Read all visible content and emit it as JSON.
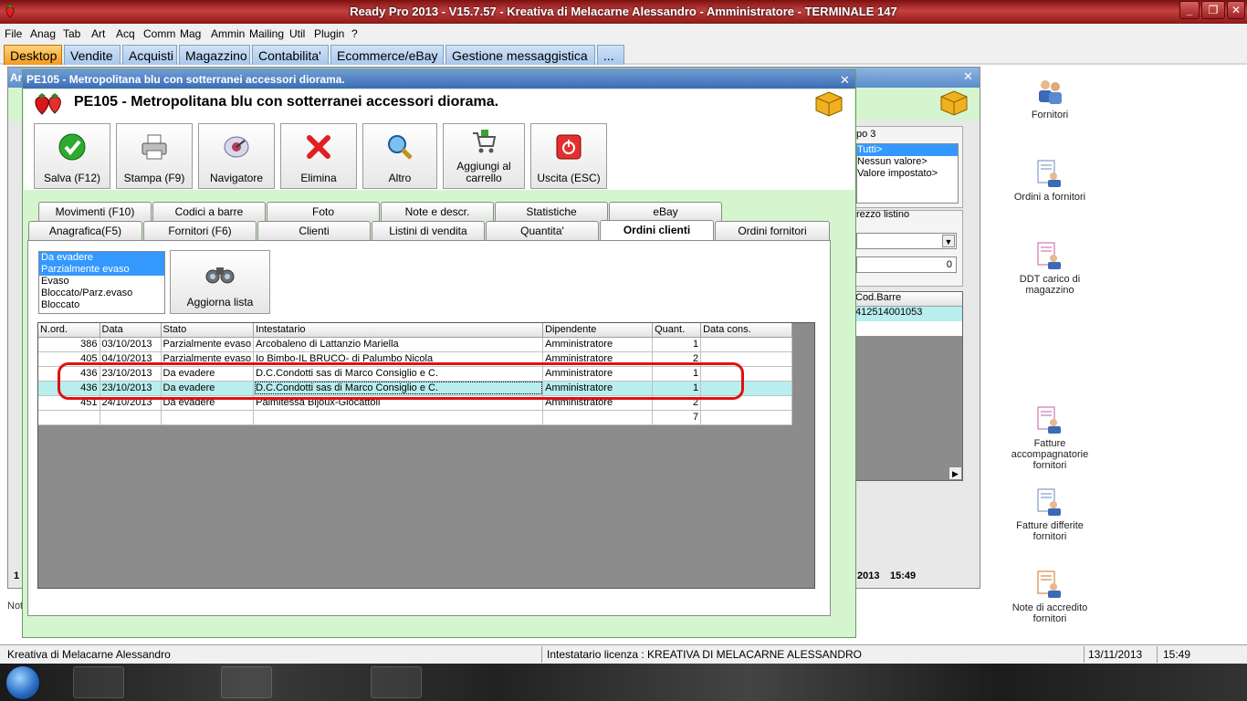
{
  "window": {
    "title": "Ready Pro 2013 - V15.7.57 - Kreativa di Melacarne Alessandro - Amministratore - TERMINALE 147"
  },
  "menu": [
    "File",
    "Anag",
    "Tab",
    "Art",
    "Acq",
    "Comm",
    "Mag",
    "Ammin",
    "Mailing",
    "Util",
    "Plugin",
    "?"
  ],
  "main_tabs": [
    "Desktop",
    "Vendite",
    "Acquisti",
    "Magazzino",
    "Contabilita'",
    "Ecommerce/eBay",
    "Gestione messaggistica",
    "..."
  ],
  "desktop_icons": [
    {
      "label": "Fornitori",
      "icon": "suppliers-icon"
    },
    {
      "label": "Ordini a fornitori",
      "icon": "supplier-orders-icon"
    },
    {
      "label": "DDT carico di magazzino",
      "icon": "ddt-icon"
    },
    {
      "label": "Fatture accompagnatorie fornitori",
      "icon": "invoice-icon"
    },
    {
      "label": "Fatture differite fornitori",
      "icon": "deferred-invoice-icon"
    },
    {
      "label": "Note di accredito fornitori",
      "icon": "credit-note-icon"
    }
  ],
  "back_window": {
    "title_fragment": "Ar",
    "group_label": "po 3",
    "group_items": [
      "Tutti>",
      "Nessun valore>",
      "Valore impostato>"
    ],
    "price_label": "rezzo listino",
    "price_value": "0",
    "barcode_header": "Cod.Barre",
    "barcode_value": "412514001053",
    "bottom_left": "1",
    "bottom_left2": "Not",
    "date_fragment": "2013",
    "time": "15:49"
  },
  "front_window": {
    "caption": "PE105 - Metropolitana blu con sotterranei accessori diorama.",
    "title": "PE105 - Metropolitana blu con sotterranei accessori diorama."
  },
  "toolbar": [
    {
      "label": "Salva (F12)",
      "icon": "check-icon"
    },
    {
      "label": "Stampa (F9)",
      "icon": "printer-icon"
    },
    {
      "label": "Navigatore",
      "icon": "navigator-icon"
    },
    {
      "label": "Elimina",
      "icon": "delete-icon"
    },
    {
      "label": "Altro",
      "icon": "magnifier-icon"
    },
    {
      "label": "Aggiungi al carrello",
      "icon": "cart-icon"
    },
    {
      "label": "Uscita (ESC)",
      "icon": "exit-icon"
    }
  ],
  "tabs_row1": [
    "Movimenti (F10)",
    "Codici a barre",
    "Foto",
    "Note e descr.",
    "Statistiche",
    "eBay"
  ],
  "tabs_row2": [
    "Anagrafica(F5)",
    "Fornitori (F6)",
    "Clienti",
    "Listini di vendita",
    "Quantita'",
    "Ordini clienti",
    "Ordini fornitori"
  ],
  "active_tab": "Ordini clienti",
  "status_filter": {
    "items": [
      "Da evadere",
      "Parzialmente evaso",
      "Evaso",
      "Bloccato/Parz.evaso",
      "Bloccato"
    ],
    "selected": [
      "Da evadere",
      "Parzialmente evaso"
    ]
  },
  "refresh_button": {
    "label": "Aggiorna lista",
    "icon": "binoculars-icon"
  },
  "orders_table": {
    "columns": [
      "N.ord.",
      "Data",
      "Stato",
      "Intestatario",
      "Dipendente",
      "Quant.",
      "Data cons."
    ],
    "rows": [
      [
        "386",
        "03/10/2013",
        "Parzialmente evaso",
        "Arcobaleno di Lattanzio Mariella",
        "Amministratore",
        "1",
        ""
      ],
      [
        "405",
        "04/10/2013",
        "Parzialmente evaso",
        "Io Bimbo-IL BRUCO- di Palumbo Nicola",
        "Amministratore",
        "2",
        ""
      ],
      [
        "436",
        "23/10/2013",
        "Da evadere",
        "D.C.Condotti sas di Marco Consiglio e C.",
        "Amministratore",
        "1",
        ""
      ],
      [
        "436",
        "23/10/2013",
        "Da evadere",
        "D.C.Condotti sas di Marco Consiglio e C.",
        "Amministratore",
        "1",
        ""
      ],
      [
        "451",
        "24/10/2013",
        "Da evadere",
        "Palmitessa Bijoux-Giocattoli",
        "Amministratore",
        "2",
        ""
      ],
      [
        "",
        "",
        "",
        "",
        "",
        "7",
        ""
      ]
    ],
    "highlighted_row": 3
  },
  "statusbar": {
    "company": "Kreativa di Melacarne Alessandro",
    "license": "Intestatario licenza : KREATIVA DI MELACARNE ALESSANDRO",
    "date": "13/11/2013",
    "time": "15:49"
  },
  "colors": {
    "accent": "#f39a1e",
    "window_bg": "#d5f5cf",
    "highlight": "#b8eeee",
    "annotation": "#e01010"
  }
}
